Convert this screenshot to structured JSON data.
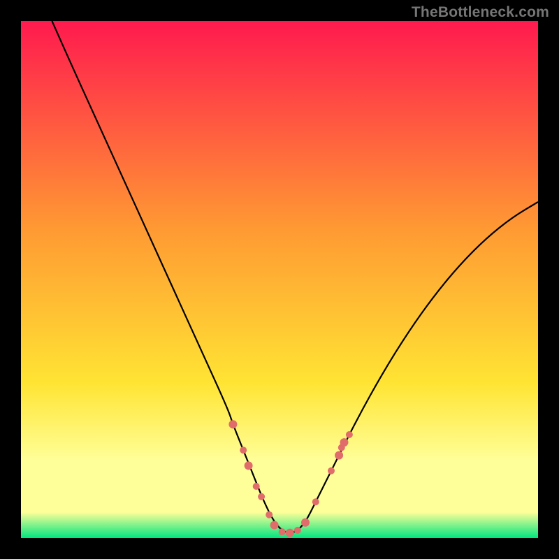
{
  "watermark": "TheBottleneck.com",
  "chart_data": {
    "type": "line",
    "title": "",
    "xlabel": "",
    "ylabel": "",
    "xlim": [
      0,
      100
    ],
    "ylim": [
      0,
      100
    ],
    "series": [
      {
        "name": "bottleneck-curve",
        "color": "#000000",
        "x": [
          6,
          10,
          15,
          20,
          25,
          30,
          35,
          40,
          41,
          43,
          45,
          47,
          49,
          51,
          53,
          55,
          57,
          60,
          65,
          70,
          75,
          80,
          85,
          90,
          95,
          100
        ],
        "y": [
          100,
          91,
          80,
          69,
          58,
          47,
          36,
          25,
          22,
          17,
          12,
          7,
          3,
          1,
          1,
          3,
          7,
          13,
          23,
          32,
          40,
          47,
          53,
          58,
          62,
          65
        ]
      }
    ],
    "scatter_points": {
      "name": "highlighted-points",
      "color": "#E06D6A",
      "radius_large": 6,
      "radius_small": 5,
      "points": [
        {
          "x": 41,
          "y": 22,
          "r": 6
        },
        {
          "x": 43,
          "y": 17,
          "r": 5
        },
        {
          "x": 44,
          "y": 14,
          "r": 6
        },
        {
          "x": 45.5,
          "y": 10,
          "r": 5
        },
        {
          "x": 46.5,
          "y": 8,
          "r": 5
        },
        {
          "x": 48,
          "y": 4.5,
          "r": 5
        },
        {
          "x": 49,
          "y": 2.5,
          "r": 6
        },
        {
          "x": 50.5,
          "y": 1.2,
          "r": 5
        },
        {
          "x": 52,
          "y": 1,
          "r": 6
        },
        {
          "x": 53.5,
          "y": 1.5,
          "r": 5
        },
        {
          "x": 55,
          "y": 3,
          "r": 6
        },
        {
          "x": 57,
          "y": 7,
          "r": 5
        },
        {
          "x": 60,
          "y": 13,
          "r": 5
        },
        {
          "x": 61.5,
          "y": 16,
          "r": 6
        },
        {
          "x": 62,
          "y": 17.5,
          "r": 5
        },
        {
          "x": 62.5,
          "y": 18.5,
          "r": 6
        },
        {
          "x": 63.5,
          "y": 20,
          "r": 5
        }
      ]
    },
    "gradient": {
      "top": "#FF1A4E",
      "mid1": "#FF9933",
      "mid2": "#FFE433",
      "band": "#FFFF99",
      "bottom": "#00E57F"
    }
  }
}
